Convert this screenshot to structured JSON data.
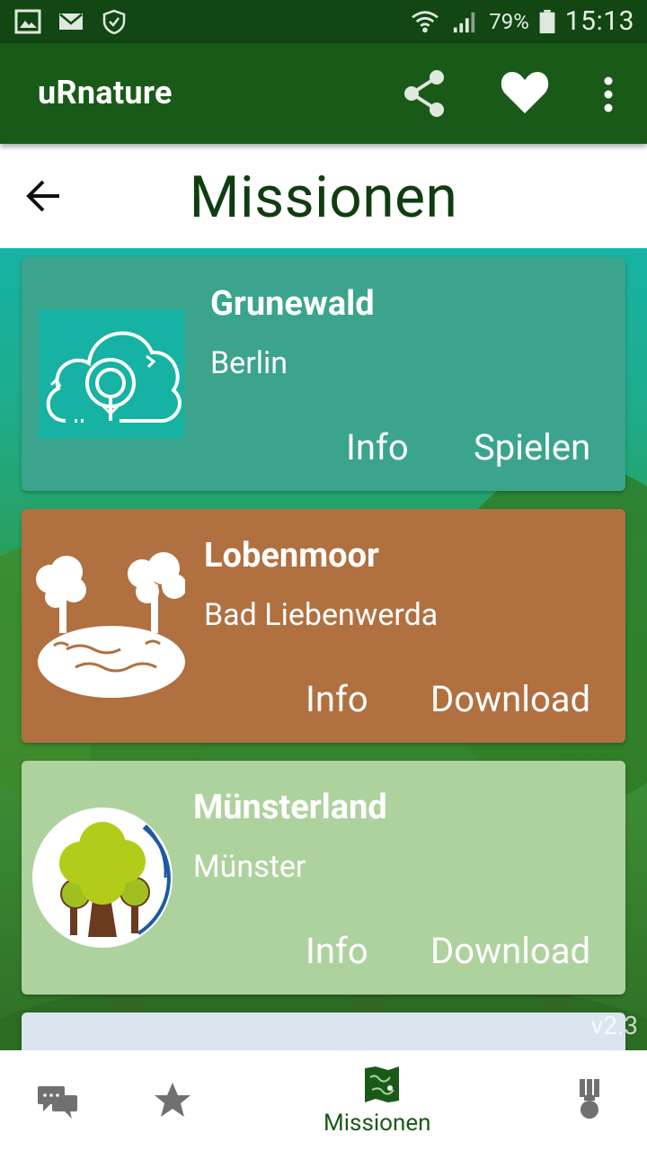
{
  "status_bar": {
    "left_icons": [
      "gallery-icon",
      "mail-icon",
      "shield-check-icon"
    ],
    "battery_percent": "79%",
    "time": "15:13"
  },
  "app_bar": {
    "title": "uRnature",
    "actions": [
      "share-icon",
      "heart-icon",
      "more-vert-icon"
    ]
  },
  "header": {
    "title": "Missionen"
  },
  "missions": [
    {
      "name": "Grunewald",
      "place": "Berlin",
      "info_label": "Info",
      "action_label": "Spielen",
      "color": "#3aa48c"
    },
    {
      "name": "Lobenmoor",
      "place": "Bad Liebenwerda",
      "info_label": "Info",
      "action_label": "Download",
      "color": "#b07040"
    },
    {
      "name": "Münsterland",
      "place": "Münster",
      "info_label": "Info",
      "action_label": "Download",
      "color": "#aed29e"
    },
    {
      "color": "#dbe5f0"
    }
  ],
  "version": "v2.3",
  "bottom_nav": {
    "items": [
      "chat-icon",
      "star-icon",
      "map-icon",
      "medal-icon"
    ],
    "active_label": "Missionen",
    "active_color": "#1a5a19"
  }
}
